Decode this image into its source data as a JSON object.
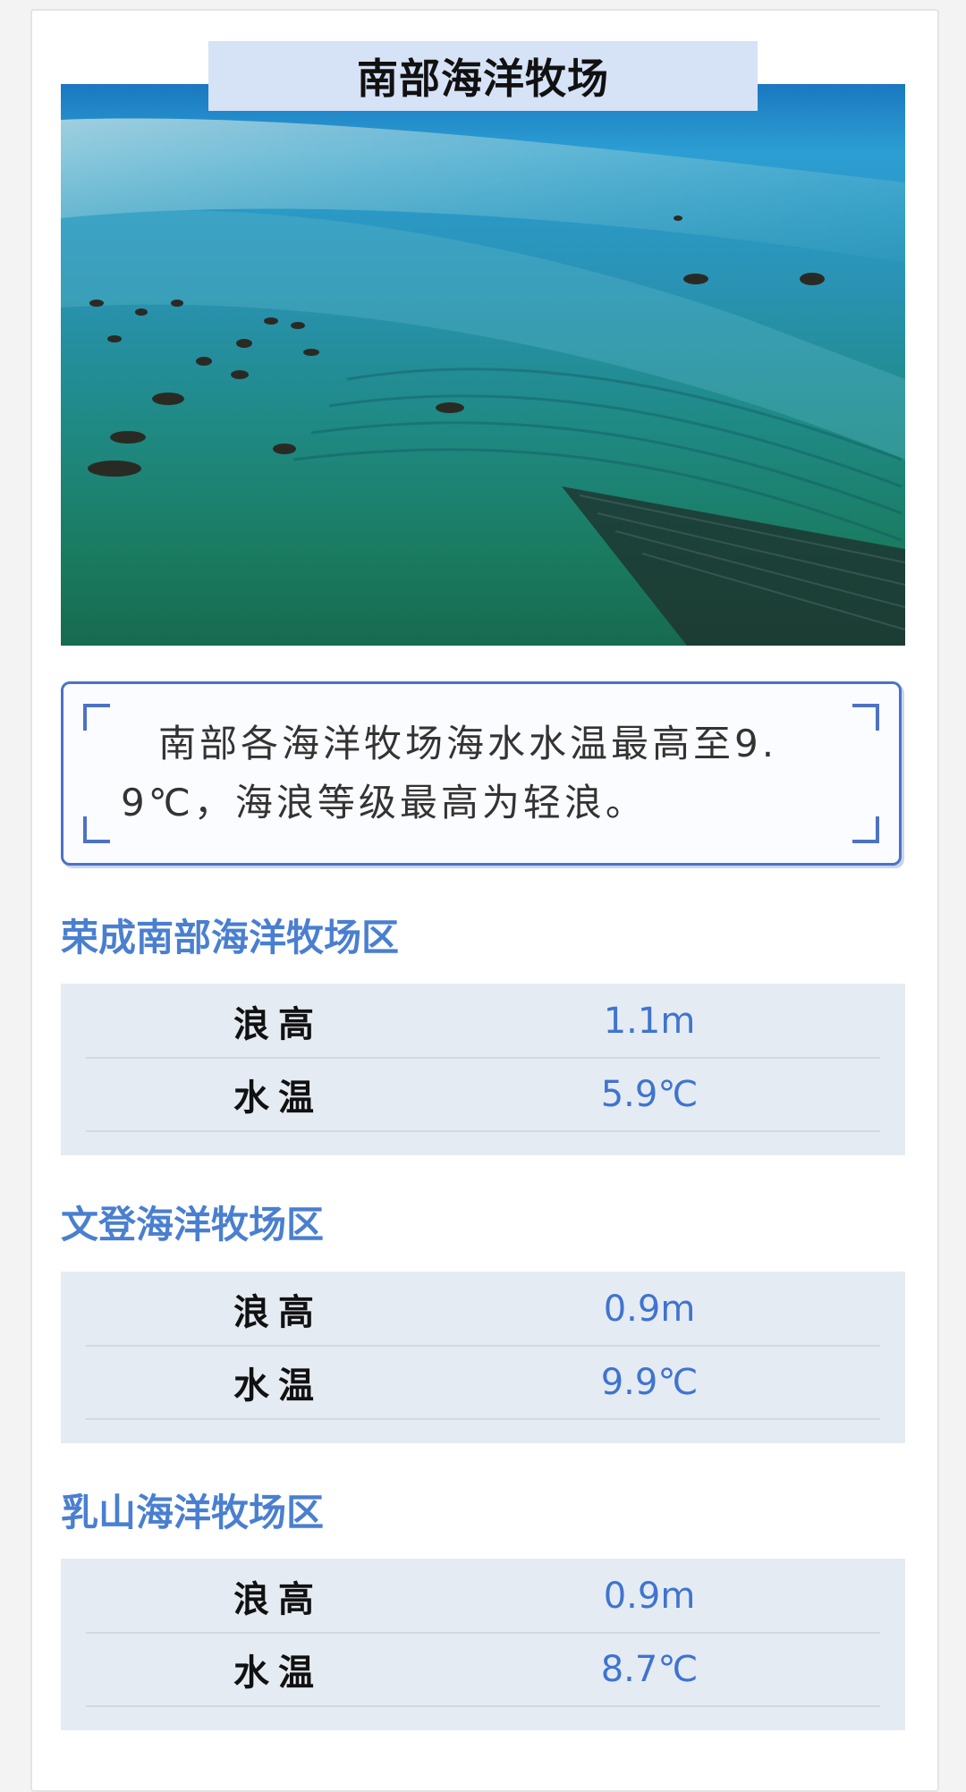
{
  "header": {
    "title": "南部海洋牧场"
  },
  "photo": {
    "subject": "aerial view of sea ranch with fishing boats and aquaculture rafts"
  },
  "summary": {
    "text": "南部各海洋牧场海水水温最高至9.9℃，海浪等级最高为轻浪。"
  },
  "zones": [
    {
      "name": "荣成南部海洋牧场区",
      "wave_label": "浪高",
      "wave_value": "1.1m",
      "temp_label": "水温",
      "temp_value": "5.9℃"
    },
    {
      "name": "文登海洋牧场区",
      "wave_label": "浪高",
      "wave_value": "0.9m",
      "temp_label": "水温",
      "temp_value": "9.9℃"
    },
    {
      "name": "乳山海洋牧场区",
      "wave_label": "浪高",
      "wave_value": "0.9m",
      "temp_label": "水温",
      "temp_value": "8.7℃"
    }
  ],
  "colors": {
    "accent": "#4a7fd0",
    "frame": "#4d72c4",
    "banner": "#d6e2f6",
    "table_bg": "#e5ebf3"
  }
}
